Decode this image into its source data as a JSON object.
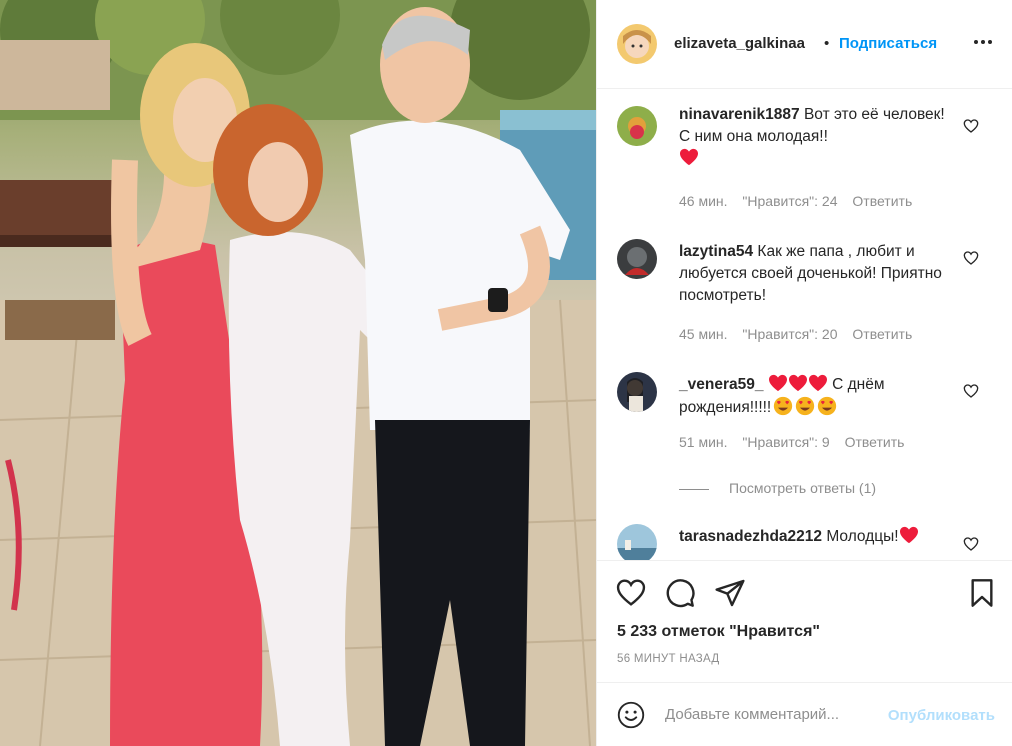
{
  "post": {
    "username": "elizaveta_galkinaa",
    "separator": "•",
    "follow_label": "Подписаться",
    "more_icon": "more-horizontal-icon"
  },
  "comments": [
    {
      "username": "ninavarenik1887",
      "text": "Вот это её человек! С ним она молодая!!",
      "emojis": [
        "red-heart"
      ],
      "time": "46 мин.",
      "likes": "\"Нравится\": 24",
      "reply": "Ответить"
    },
    {
      "username": "lazytina54",
      "text": "Как же папа , любит и любуется своей доченькой! Приятно посмотреть!",
      "emojis": [],
      "time": "45 мин.",
      "likes": "\"Нравится\": 20",
      "reply": "Ответить"
    },
    {
      "username": "_venera59_",
      "text_before": "",
      "text": "С днём рождения!!!!!",
      "emojis": [
        "red-heart",
        "red-heart",
        "red-heart",
        "heart-eyes",
        "heart-eyes",
        "heart-eyes"
      ],
      "time": "51 мин.",
      "likes": "\"Нравится\": 9",
      "reply": "Ответить",
      "view_replies": "Посмотреть ответы (1)"
    },
    {
      "username": "tarasnadezhda2212",
      "text": "Молодцы!",
      "emojis": [
        "red-heart"
      ]
    }
  ],
  "actions": {
    "likes_text": "5 233 отметок \"Нравится\"",
    "timestamp": "56 МИНУТ НАЗАД"
  },
  "composer": {
    "placeholder": "Добавьте комментарий...",
    "post_label": "Опубликовать"
  },
  "colors": {
    "link_blue": "#0095f6",
    "disabled_blue": "#b2dffc",
    "heart_red": "#ed4956",
    "muted": "#8e8e8e"
  }
}
